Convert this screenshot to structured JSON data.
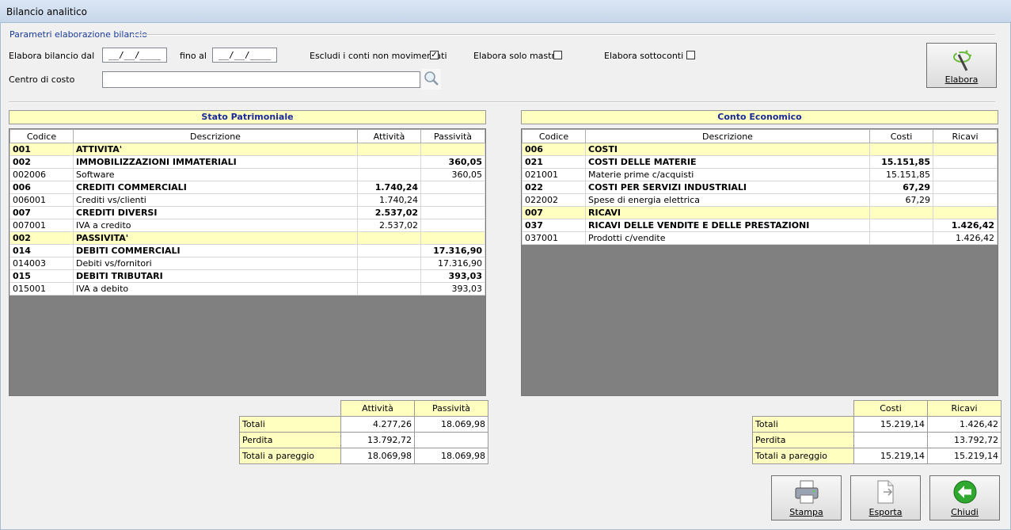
{
  "window": {
    "title": "Bilancio analitico"
  },
  "params": {
    "group_title": "Parametri elaborazione bilancio",
    "date_from_label": "Elabora bilancio dal",
    "date_from_value": "__/__/____",
    "date_to_label": "fino al",
    "date_to_value": "__/__/____",
    "exclude_label": "Escludi i conti non movimentati",
    "exclude_checked": "✓",
    "solo_mastri_label": "Elabora solo mastri",
    "sottoconti_label": "Elabora sottoconti",
    "centro_label": "Centro di costo",
    "centro_value": "",
    "elabora_button": "Elabora"
  },
  "stato": {
    "title": "Stato Patrimoniale",
    "columns": [
      "Codice",
      "Descrizione",
      "Attività",
      "Passività"
    ],
    "rows": [
      {
        "type": "hdr",
        "code": "001",
        "desc": "ATTIVITA'",
        "a": "",
        "b": ""
      },
      {
        "type": "bold",
        "code": "002",
        "desc": "IMMOBILIZZAZIONI IMMATERIALI",
        "a": "",
        "b": "360,05"
      },
      {
        "type": "norm",
        "code": "002006",
        "desc": "Software",
        "a": "",
        "b": "360,05"
      },
      {
        "type": "bold",
        "code": "006",
        "desc": "CREDITI COMMERCIALI",
        "a": "1.740,24",
        "b": ""
      },
      {
        "type": "norm",
        "code": "006001",
        "desc": "Crediti vs/clienti",
        "a": "1.740,24",
        "b": ""
      },
      {
        "type": "bold",
        "code": "007",
        "desc": "CREDITI DIVERSI",
        "a": "2.537,02",
        "b": ""
      },
      {
        "type": "norm",
        "code": "007001",
        "desc": "IVA a credito",
        "a": "2.537,02",
        "b": ""
      },
      {
        "type": "hdr",
        "code": "002",
        "desc": "PASSIVITA'",
        "a": "",
        "b": ""
      },
      {
        "type": "bold",
        "code": "014",
        "desc": "DEBITI COMMERCIALI",
        "a": "",
        "b": "17.316,90"
      },
      {
        "type": "norm",
        "code": "014003",
        "desc": "Debiti vs/fornitori",
        "a": "",
        "b": "17.316,90"
      },
      {
        "type": "bold",
        "code": "015",
        "desc": "DEBITI TRIBUTARI",
        "a": "",
        "b": "393,03"
      },
      {
        "type": "norm",
        "code": "015001",
        "desc": "IVA a debito",
        "a": "",
        "b": "393,03"
      }
    ],
    "totals_headers": [
      "Attività",
      "Passività"
    ],
    "totals": [
      {
        "label": "Totali",
        "a": "4.277,26",
        "b": "18.069,98"
      },
      {
        "label": "Perdita",
        "a": "13.792,72",
        "b": ""
      },
      {
        "label": "Totali a pareggio",
        "a": "18.069,98",
        "b": "18.069,98"
      }
    ]
  },
  "conto": {
    "title": "Conto Economico",
    "columns": [
      "Codice",
      "Descrizione",
      "Costi",
      "Ricavi"
    ],
    "rows": [
      {
        "type": "hdr",
        "code": "006",
        "desc": "COSTI",
        "a": "",
        "b": ""
      },
      {
        "type": "bold",
        "code": "021",
        "desc": "COSTI DELLE MATERIE",
        "a": "15.151,85",
        "b": ""
      },
      {
        "type": "norm",
        "code": "021001",
        "desc": "Materie prime c/acquisti",
        "a": "15.151,85",
        "b": ""
      },
      {
        "type": "bold",
        "code": "022",
        "desc": "COSTI PER SERVIZI INDUSTRIALI",
        "a": "67,29",
        "b": ""
      },
      {
        "type": "norm",
        "code": "022002",
        "desc": "Spese di energia elettrica",
        "a": "67,29",
        "b": ""
      },
      {
        "type": "hdr",
        "code": "007",
        "desc": "RICAVI",
        "a": "",
        "b": ""
      },
      {
        "type": "bold",
        "code": "037",
        "desc": "RICAVI DELLE VENDITE E DELLE PRESTAZIONI",
        "a": "",
        "b": "1.426,42"
      },
      {
        "type": "norm",
        "code": "037001",
        "desc": "Prodotti c/vendite",
        "a": "",
        "b": "1.426,42"
      }
    ],
    "totals_headers": [
      "Costi",
      "Ricavi"
    ],
    "totals": [
      {
        "label": "Totali",
        "a": "15.219,14",
        "b": "1.426,42"
      },
      {
        "label": "Perdita",
        "a": "",
        "b": "13.792,72"
      },
      {
        "label": "Totali a pareggio",
        "a": "15.219,14",
        "b": "15.219,14"
      }
    ]
  },
  "footer": {
    "stampa": "Stampa",
    "esporta": "Esporta",
    "chiudi": "Chiudi"
  }
}
